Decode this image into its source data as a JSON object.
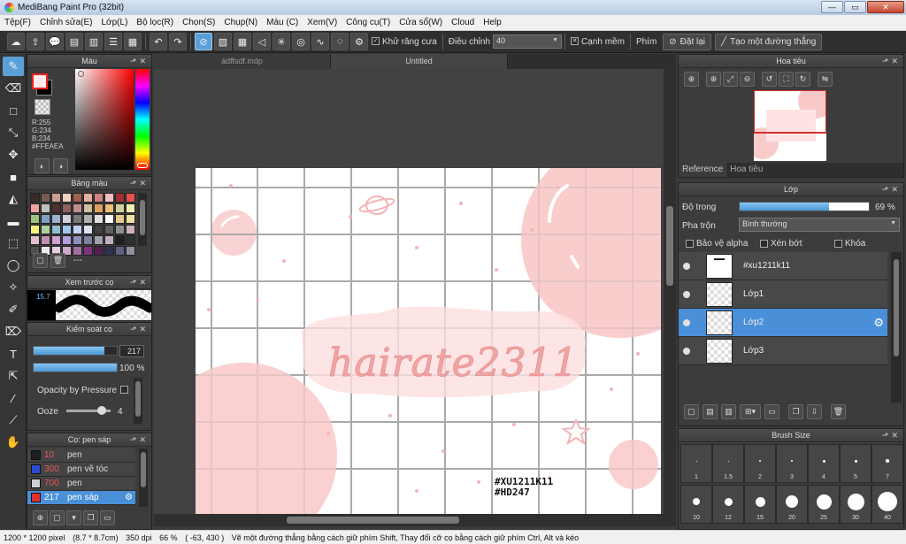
{
  "window": {
    "title": "MediBang Paint Pro (32bit)",
    "minimize": "—",
    "restore": "▭",
    "close": "✕"
  },
  "menu": [
    "Tệp(F)",
    "Chỉnh sửa(E)",
    "Lớp(L)",
    "Bộ lọc(R)",
    "Chọn(S)",
    "Chụp(N)",
    "Màu (C)",
    "Xem(V)",
    "Công cụ(T)",
    "Cửa sổ(W)",
    "Cloud",
    "Help"
  ],
  "toolbar": {
    "antialias_label": "Khử răng cưa",
    "adjust_label": "Điều chỉnh",
    "adjust_value": "40",
    "smooth_label": "Cạnh mềm",
    "keys_label": "Phím",
    "reset_label": "Đặt lại",
    "straight_line_label": "Tạo một đường thẳng"
  },
  "tabs": [
    "ádffsdf.mdp",
    "Untitled"
  ],
  "color_panel": {
    "title": "Màu",
    "r": "R:255",
    "g": "G:234",
    "b": "B:234",
    "hex": "#FFEAEA",
    "fg_color": "#ffeaea",
    "bg_color": "#000000"
  },
  "palette_panel": {
    "title": "Bảng màu",
    "dash": "---",
    "swatches": [
      "#3a2a2a",
      "#7a5a55",
      "#c8a090",
      "#f0d0c0",
      "#a06050",
      "#e0b0a0",
      "#d08080",
      "#f0c0c8",
      "#a03030",
      "#e85050",
      "#f0a0a0",
      "#c0c0c0",
      "#503030",
      "#906060",
      "#c09090",
      "#d0c0a0",
      "#e0a060",
      "#f0c070",
      "#d0d0a0",
      "#f0f0b0",
      "#a0c080",
      "#80a0c0",
      "#a0b0d0",
      "#d0d0e0",
      "#7a7a7a",
      "#b0b0b0",
      "#e0e0e0",
      "#ffffff",
      "#e8c890",
      "#f0e0a0",
      "#f8f080",
      "#b0d0a0",
      "#90c0d0",
      "#a0c8f0",
      "#c0d0f8",
      "#e0e0f0",
      "#404040",
      "#606060",
      "#909090",
      "#d0b0c0",
      "#e0c0d0",
      "#c090b0",
      "#d0a0d0",
      "#b0a0e0",
      "#9090c0",
      "#8080a0",
      "#a0a0b0",
      "#c0b0c0",
      "#202020",
      "#303030",
      "#505050",
      "#f0e8f0",
      "#e8d0e0",
      "#d0a8c8",
      "#a070a0",
      "#803080",
      "#502050",
      "#303050",
      "#606080",
      "#9090a0"
    ]
  },
  "preview_panel": {
    "title": "Xem trước cọ",
    "size": "15.7"
  },
  "brush_control": {
    "title": "Kiểm soát cọ",
    "size_value": "217",
    "size_fraction": 0.85,
    "opacity_value": "100 %",
    "opacity_fraction": 1.0,
    "pressure_label": "Opacity by Pressure",
    "ooze_label": "Ooze",
    "ooze_value": "4",
    "ooze_fraction": 0.7
  },
  "brush_list": {
    "title": "Cọ: pen sáp",
    "items": [
      {
        "size": "10",
        "name": "pen",
        "color": "#202020"
      },
      {
        "size": "300",
        "name": "pen vẽ tóc",
        "color": "#2a4ad8"
      },
      {
        "size": "700",
        "name": "pen",
        "color": "#d0d0d0"
      },
      {
        "size": "217",
        "name": "pen sáp",
        "color": "#e03030"
      }
    ]
  },
  "navigator": {
    "title": "Hoa tiêu",
    "tab_reference": "Reference",
    "tab_navigator": "Hoa tiêu"
  },
  "layer_panel": {
    "title": "Lớp",
    "opacity_label": "Độ trong",
    "opacity_value": "69 %",
    "opacity_fraction": 0.69,
    "blend_label": "Pha trộn",
    "blend_value": "Bình thường",
    "protect_alpha": "Bảo vệ alpha",
    "clipping": "Xén bớt",
    "lock": "Khóa",
    "layers": [
      {
        "name": "#xu1211k11"
      },
      {
        "name": "Lớp1"
      },
      {
        "name": "Lớp2"
      },
      {
        "name": "Lớp3"
      }
    ]
  },
  "brush_size": {
    "title": "Brush Size",
    "row1": [
      "1",
      "1.5",
      "2",
      "3",
      "4",
      "5",
      "7"
    ],
    "row2": [
      "10",
      "12",
      "15",
      "20",
      "25",
      "30",
      "40"
    ]
  },
  "canvas": {
    "title_text": "hairate2311",
    "tag_line1": "#XU1211K11",
    "tag_line2": "#HD247",
    "pink": "#f9c9c9",
    "pink_light": "#fde3e3",
    "grid_color": "#8a8a8a"
  },
  "status": {
    "size": "1200 * 1200 pixel",
    "dims": "(8.7 * 8.7cm)",
    "dpi": "350 dpi",
    "zoom": "66 %",
    "coords": "( -63, 430 )",
    "hint": "Vẽ một đường thẳng bằng cách giữ phím Shift, Thay đổi cỡ cọ bằng cách giữ phím Ctrl, Alt và kéo"
  }
}
